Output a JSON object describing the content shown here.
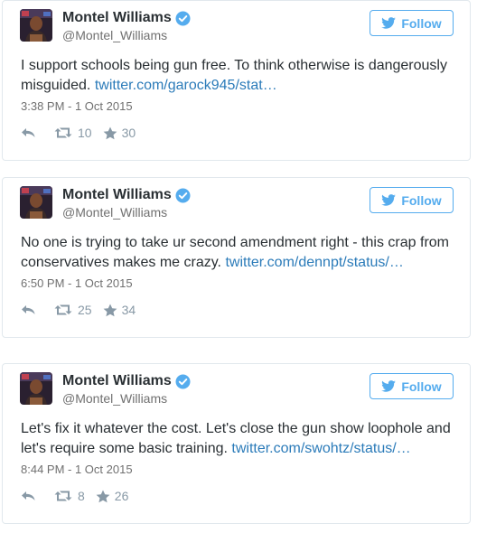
{
  "colors": {
    "twitter_blue": "#55acee",
    "link_blue": "#2b7bb9",
    "text_dark": "#292f33",
    "text_muted": "#707070",
    "icon_grey": "#8899a6",
    "card_border": "#e1e8ed"
  },
  "tweets": [
    {
      "author_name": "Montel Williams",
      "author_handle": "@Montel_Williams",
      "verified": true,
      "follow_label": "Follow",
      "text": "I support schools being gun free. To think otherwise is dangerously misguided. ",
      "link": "twitter.com/garock945/stat…",
      "timestamp": "3:38 PM - 1 Oct 2015",
      "retweets": "10",
      "likes": "30",
      "icons": [
        "reply-icon",
        "retweet-icon",
        "star-icon"
      ]
    },
    {
      "author_name": "Montel Williams",
      "author_handle": "@Montel_Williams",
      "verified": true,
      "follow_label": "Follow",
      "text": "No one is trying to take ur second amendment right - this crap from conservatives makes me crazy. ",
      "link": "twitter.com/dennpt/status/…",
      "timestamp": "6:50 PM - 1 Oct 2015",
      "retweets": "25",
      "likes": "34",
      "icons": [
        "reply-icon",
        "retweet-icon",
        "star-icon"
      ]
    },
    {
      "author_name": "Montel Williams",
      "author_handle": "@Montel_Williams",
      "verified": true,
      "follow_label": "Follow",
      "text": "Let's fix it whatever the cost. Let's close the gun show loophole and let's require some basic training. ",
      "link": "twitter.com/swohtz/status/…",
      "timestamp": "8:44 PM - 1 Oct 2015",
      "retweets": "8",
      "likes": "26",
      "icons": [
        "reply-icon",
        "retweet-icon",
        "star-icon"
      ]
    }
  ]
}
